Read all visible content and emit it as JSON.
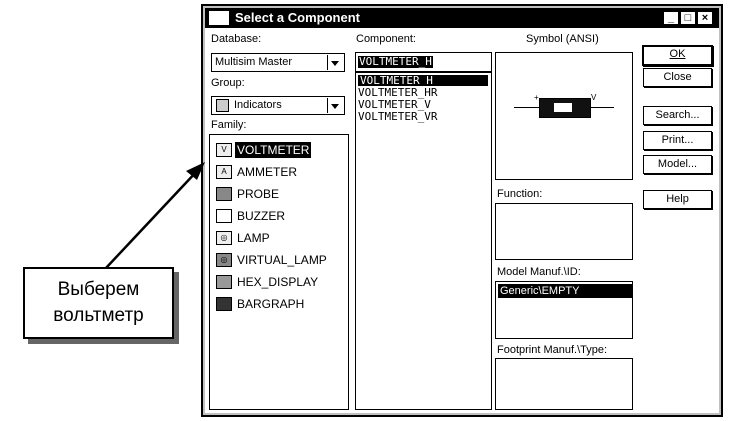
{
  "window": {
    "title": "Select a Component",
    "controls": [
      "_",
      "□",
      "×"
    ]
  },
  "database": {
    "label": "Database:",
    "value": "Multisim Master"
  },
  "group": {
    "label": "Group:",
    "value": "Indicators",
    "icon": "indicator-icon"
  },
  "family": {
    "label": "Family:",
    "items": [
      {
        "label": "VOLTMETER",
        "icon": "voltmeter-icon",
        "selected": true
      },
      {
        "label": "AMMETER",
        "icon": "ammeter-icon"
      },
      {
        "label": "PROBE",
        "icon": "probe-icon"
      },
      {
        "label": "BUZZER",
        "icon": "buzzer-icon"
      },
      {
        "label": "LAMP",
        "icon": "lamp-icon"
      },
      {
        "label": "VIRTUAL_LAMP",
        "icon": "virtual-lamp-icon"
      },
      {
        "label": "HEX_DISPLAY",
        "icon": "hex-display-icon"
      },
      {
        "label": "BARGRAPH",
        "icon": "bargraph-icon"
      }
    ]
  },
  "component": {
    "label": "Component:",
    "input_value": "VOLTMETER_H",
    "items": [
      {
        "label": "VOLTMETER_H",
        "selected": true
      },
      {
        "label": "VOLTMETER_HR"
      },
      {
        "label": "VOLTMETER_V"
      },
      {
        "label": "VOLTMETER_VR"
      }
    ]
  },
  "symbol": {
    "label": "Symbol (ANSI)",
    "pin_left": "+",
    "pin_right": "V"
  },
  "function": {
    "label": "Function:"
  },
  "model": {
    "label": "Model Manuf.\\ID:",
    "selected": "Generic\\EMPTY"
  },
  "footprint": {
    "label": "Footprint Manuf.\\Type:"
  },
  "buttons": {
    "ok": "OK",
    "close": "Close",
    "search": "Search...",
    "print": "Print...",
    "model": "Model...",
    "help": "Help"
  },
  "callout": {
    "line1": "Выберем",
    "line2": "вольтметр"
  }
}
